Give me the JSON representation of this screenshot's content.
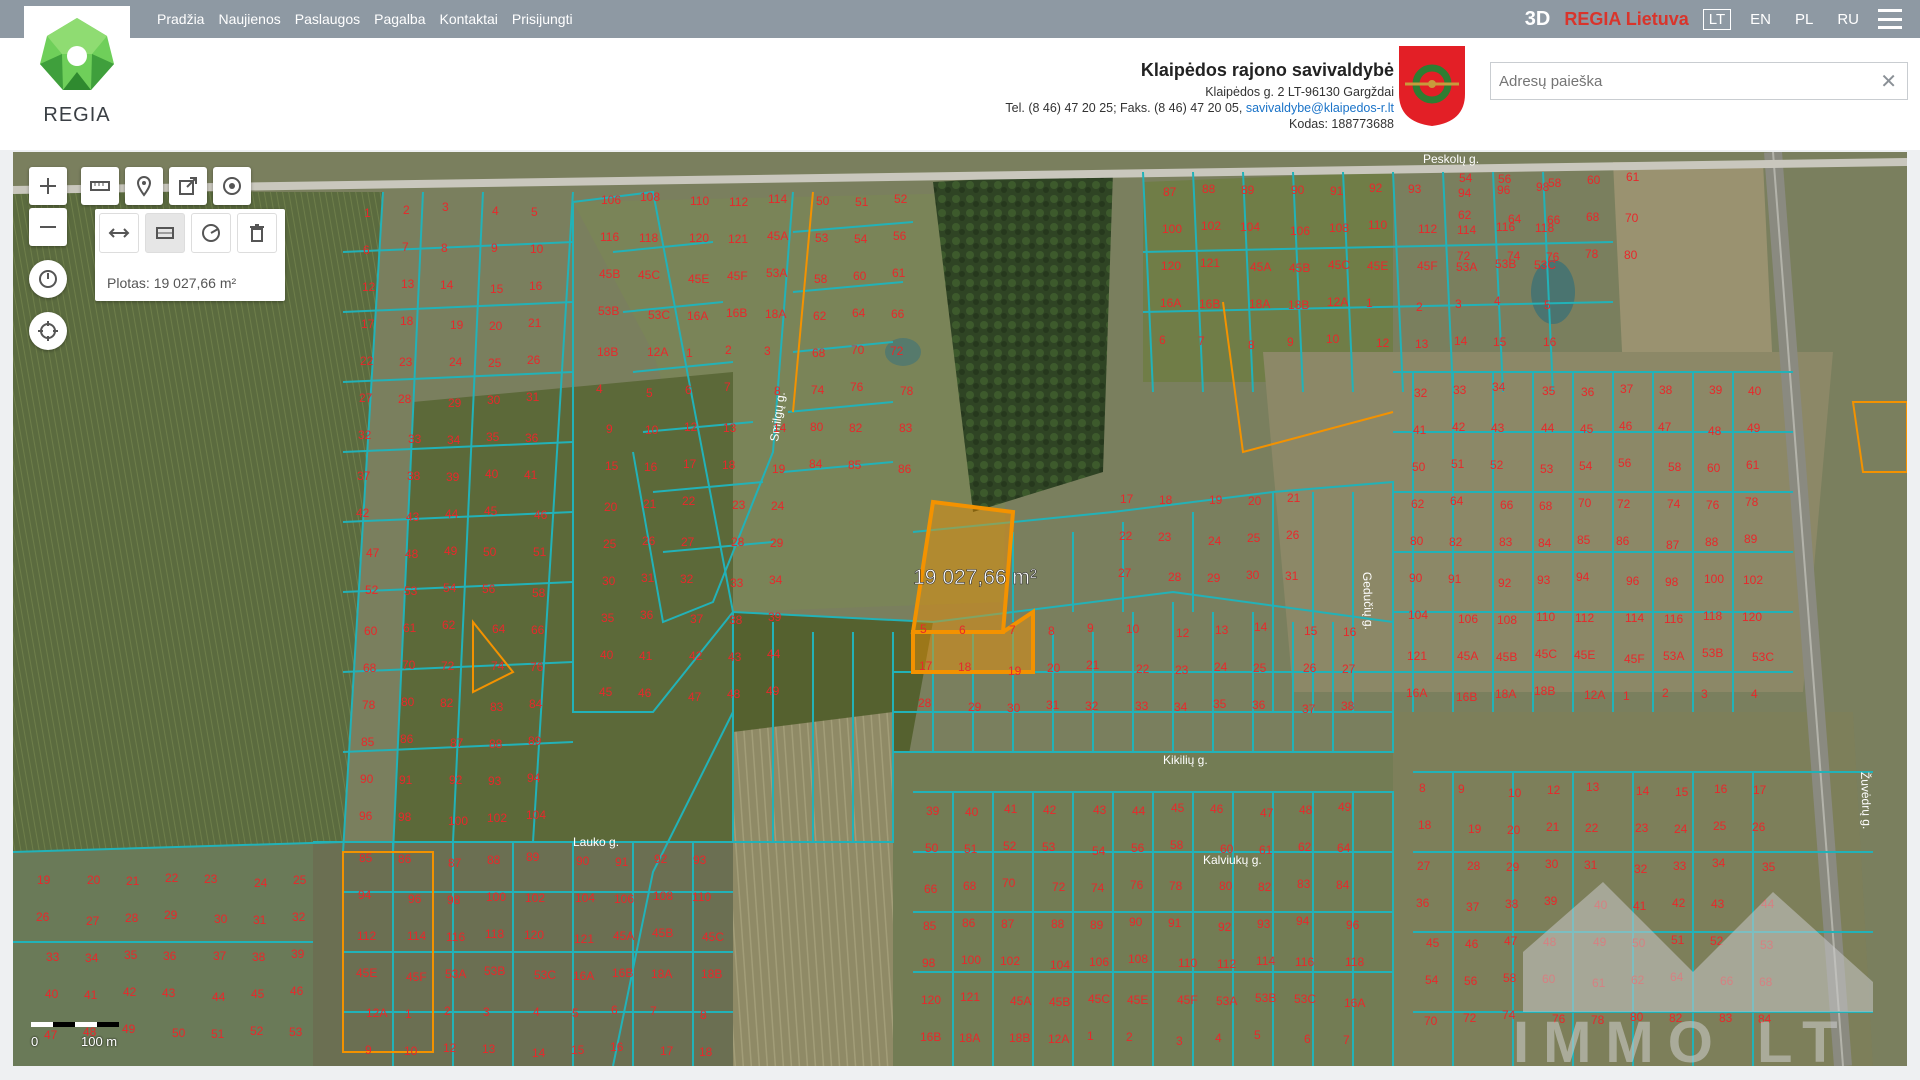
{
  "nav": {
    "items": [
      "Pradžia",
      "Naujienos",
      "Paslaugos",
      "Pagalba",
      "Kontaktai",
      "Prisijungti"
    ]
  },
  "topbar": {
    "btn_3d": "3D",
    "regia_lietuva": "REGIA Lietuva",
    "languages": [
      "LT",
      "EN",
      "PL",
      "RU"
    ],
    "active_language": "LT"
  },
  "logo": {
    "text": "REGIA"
  },
  "municipality": {
    "name": "Klaipėdos rajono savivaldybė",
    "address": "Klaipėdos g. 2 LT-96130 Gargždai",
    "phone": "Tel. (8 46) 47 20 25; Faks. (8 46) 47 20 05, ",
    "email": "savivaldybe@klaipedos-r.lt",
    "code": "Kodas: 188773688"
  },
  "search": {
    "placeholder": "Adresų paieška",
    "value": ""
  },
  "map": {
    "measure_area_label": "Plotas: 19 027,66 m²",
    "selected_area_overlay": "19 027,66 m²",
    "scale_start": "0",
    "scale_end": "100 m",
    "watermark": "IMMO LT",
    "streets": [
      "Peskolų g.",
      "Lauko g.",
      "Kikilių g.",
      "Kalviukų g.",
      "Smilgų g.",
      "Gedučių g.",
      "Žuvėdrų g."
    ],
    "parcel_numbers": [
      "1",
      "2",
      "3",
      "4",
      "5",
      "6",
      "7",
      "8",
      "9",
      "10",
      "12",
      "13",
      "14",
      "15",
      "16",
      "17",
      "18",
      "19",
      "20",
      "21",
      "22",
      "23",
      "24",
      "25",
      "26",
      "27",
      "28",
      "29",
      "30",
      "31",
      "32",
      "33",
      "34",
      "35",
      "36",
      "37",
      "38",
      "39",
      "40",
      "41",
      "42",
      "43",
      "44",
      "45",
      "46",
      "47",
      "48",
      "49",
      "50",
      "51",
      "52",
      "53",
      "54",
      "56",
      "58",
      "60",
      "61",
      "62",
      "64",
      "66",
      "68",
      "70",
      "72",
      "74",
      "76",
      "78",
      "80",
      "82",
      "83",
      "84",
      "85",
      "86",
      "87",
      "88",
      "89",
      "90",
      "91",
      "92",
      "93",
      "94",
      "96",
      "98",
      "100",
      "102",
      "104",
      "106",
      "108",
      "110",
      "112",
      "114",
      "116",
      "118",
      "120",
      "121",
      "45A",
      "45B",
      "45C",
      "45E",
      "45F",
      "53A",
      "53B",
      "53C",
      "16A",
      "16B",
      "18A",
      "18B",
      "12A"
    ]
  },
  "colors": {
    "topbar": "#8e99a3",
    "parcel_lines": "#22b2b8",
    "parcel_numbers": "#e8282b",
    "selection": "#f39200",
    "regia_red": "#d9342b",
    "logo_green": "#4caf50"
  }
}
